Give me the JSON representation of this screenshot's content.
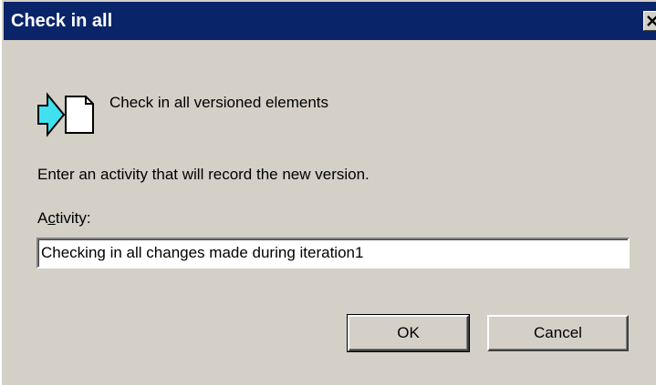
{
  "window": {
    "title": "Check in all",
    "close_glyph": "✕"
  },
  "header": {
    "icon": "check-in-arrow-document-icon",
    "description": "Check in all versioned elements"
  },
  "form": {
    "instruction": "Enter an activity that will record the new version.",
    "activity_label_prefix": "A",
    "activity_label_accel": "c",
    "activity_label_suffix": "tivity:",
    "activity_value": "Checking in all changes made during iteration1"
  },
  "buttons": {
    "ok_label": "OK",
    "cancel_label": "Cancel"
  },
  "colors": {
    "titlebar": "#0a246a",
    "dialog_face": "#d4d0c8",
    "arrow_fill": "#40e0f0"
  }
}
